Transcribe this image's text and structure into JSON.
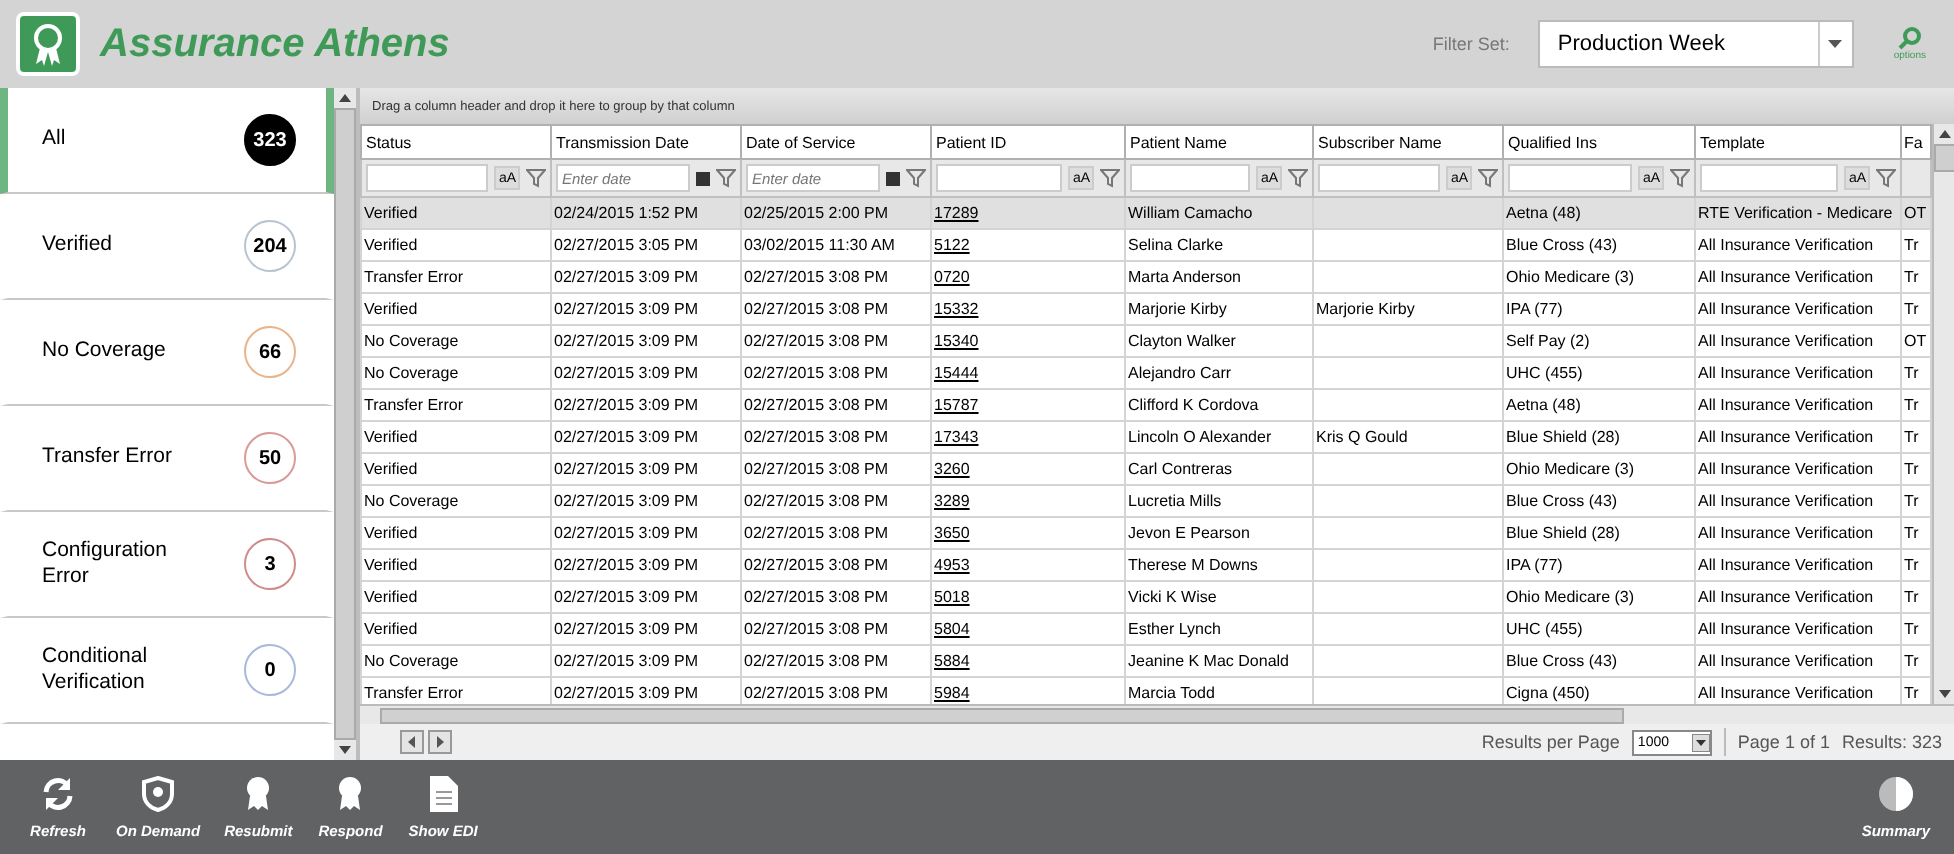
{
  "header": {
    "title": "Assurance Athens",
    "filter_label": "Filter Set:",
    "filter_value": "Production Week",
    "options_label": "options"
  },
  "sidebar": {
    "items": [
      {
        "label": "All",
        "count": "323",
        "selected": true,
        "color": "#000000"
      },
      {
        "label": "Verified",
        "count": "204",
        "selected": false,
        "color": "#b8c4d0"
      },
      {
        "label": "No Coverage",
        "count": "66",
        "selected": false,
        "color": "#e8b48c"
      },
      {
        "label": "Transfer Error",
        "count": "50",
        "selected": false,
        "color": "#d99a9a"
      },
      {
        "label": "Configuration Error",
        "count": "3",
        "selected": false,
        "color": "#d08c8c"
      },
      {
        "label": "Conditional Verification",
        "count": "0",
        "selected": false,
        "color": "#a9b8dc"
      }
    ]
  },
  "grid": {
    "group_hint": "Drag a column header and drop it here to group by that column",
    "columns": [
      {
        "title": "Status",
        "kind": "text",
        "case_toggle": "aA"
      },
      {
        "title": "Transmission Date",
        "kind": "date",
        "placeholder": "Enter date"
      },
      {
        "title": "Date of Service",
        "kind": "date",
        "placeholder": "Enter date"
      },
      {
        "title": "Patient ID",
        "kind": "link",
        "case_toggle": "aA"
      },
      {
        "title": "Patient Name",
        "kind": "text",
        "case_toggle": "aA"
      },
      {
        "title": "Subscriber Name",
        "kind": "text",
        "case_toggle": "aA"
      },
      {
        "title": "Qualified Ins",
        "kind": "text",
        "case_toggle": "aA"
      },
      {
        "title": "Template",
        "kind": "text",
        "case_toggle": "aA"
      },
      {
        "title": "Fa",
        "kind": "plain"
      }
    ],
    "rows": [
      {
        "selected": true,
        "cells": [
          "Verified",
          "02/24/2015 1:52 PM",
          "02/25/2015 2:00 PM",
          "17289",
          "William  Camacho",
          "",
          "Aetna (48)",
          "RTE Verification - Medicare",
          "OT"
        ]
      },
      {
        "selected": false,
        "cells": [
          "Verified",
          "02/27/2015 3:05 PM",
          "03/02/2015 11:30 AM",
          "5122",
          "Selina  Clarke",
          "",
          "Blue Cross (43)",
          "All Insurance Verification",
          "Tr"
        ]
      },
      {
        "selected": false,
        "cells": [
          "Transfer Error",
          "02/27/2015 3:09 PM",
          "02/27/2015 3:08 PM",
          "0720",
          "Marta  Anderson",
          "",
          "Ohio Medicare (3)",
          "All Insurance Verification",
          "Tr"
        ]
      },
      {
        "selected": false,
        "cells": [
          "Verified",
          "02/27/2015 3:09 PM",
          "02/27/2015 3:08 PM",
          "15332",
          "Marjorie  Kirby",
          "Marjorie Kirby",
          "IPA (77)",
          "All Insurance Verification",
          "Tr"
        ]
      },
      {
        "selected": false,
        "cells": [
          "No Coverage",
          "02/27/2015 3:09 PM",
          "02/27/2015 3:08 PM",
          "15340",
          "Clayton  Walker",
          "",
          "Self Pay (2)",
          "All Insurance Verification",
          "OT"
        ]
      },
      {
        "selected": false,
        "cells": [
          "No Coverage",
          "02/27/2015 3:09 PM",
          "02/27/2015 3:08 PM",
          "15444",
          "Alejandro  Carr",
          "",
          "UHC (455)",
          "All Insurance Verification",
          "Tr"
        ]
      },
      {
        "selected": false,
        "cells": [
          "Transfer Error",
          "02/27/2015 3:09 PM",
          "02/27/2015 3:08 PM",
          "15787",
          "Clifford K Cordova",
          "",
          "Aetna (48)",
          "All Insurance Verification",
          "Tr"
        ]
      },
      {
        "selected": false,
        "cells": [
          "Verified",
          "02/27/2015 3:09 PM",
          "02/27/2015 3:08 PM",
          "17343",
          "Lincoln O Alexander",
          "Kris Q Gould",
          "Blue Shield (28)",
          "All Insurance Verification",
          "Tr"
        ]
      },
      {
        "selected": false,
        "cells": [
          "Verified",
          "02/27/2015 3:09 PM",
          "02/27/2015 3:08 PM",
          "3260",
          "Carl  Contreras",
          "",
          "Ohio Medicare (3)",
          "All Insurance Verification",
          "Tr"
        ]
      },
      {
        "selected": false,
        "cells": [
          "No Coverage",
          "02/27/2015 3:09 PM",
          "02/27/2015 3:08 PM",
          "3289",
          "Lucretia  Mills",
          "",
          "Blue Cross (43)",
          "All Insurance Verification",
          "Tr"
        ]
      },
      {
        "selected": false,
        "cells": [
          "Verified",
          "02/27/2015 3:09 PM",
          "02/27/2015 3:08 PM",
          "3650",
          "Jevon E Pearson",
          "",
          "Blue Shield (28)",
          "All Insurance Verification",
          "Tr"
        ]
      },
      {
        "selected": false,
        "cells": [
          "Verified",
          "02/27/2015 3:09 PM",
          "02/27/2015 3:08 PM",
          "4953",
          "Therese M Downs",
          "",
          "IPA (77)",
          "All Insurance Verification",
          "Tr"
        ]
      },
      {
        "selected": false,
        "cells": [
          "Verified",
          "02/27/2015 3:09 PM",
          "02/27/2015 3:08 PM",
          "5018",
          "Vicki K Wise",
          "",
          "Ohio Medicare (3)",
          "All Insurance Verification",
          "Tr"
        ]
      },
      {
        "selected": false,
        "cells": [
          "Verified",
          "02/27/2015 3:09 PM",
          "02/27/2015 3:08 PM",
          "5804",
          "Esther  Lynch",
          "",
          "UHC (455)",
          "All Insurance Verification",
          "Tr"
        ]
      },
      {
        "selected": false,
        "cells": [
          "No Coverage",
          "02/27/2015 3:09 PM",
          "02/27/2015 3:08 PM",
          "5884",
          "Jeanine K Mac Donald",
          "",
          "Blue Cross (43)",
          "All Insurance Verification",
          "Tr"
        ]
      },
      {
        "selected": false,
        "cells": [
          "Transfer Error",
          "02/27/2015 3:09 PM",
          "02/27/2015 3:08 PM",
          "5984",
          "Marcia  Todd",
          "",
          "Cigna (450)",
          "All Insurance Verification",
          "Tr"
        ]
      }
    ]
  },
  "pager": {
    "results_per_page_label": "Results per Page",
    "page_size": "1000",
    "page_info": "Page 1 of 1",
    "results": "Results: 323"
  },
  "toolbar": [
    {
      "label": "Refresh",
      "kind": "refresh"
    },
    {
      "label": "On Demand",
      "kind": "shield"
    },
    {
      "label": "Resubmit",
      "kind": "ribbon"
    },
    {
      "label": "Respond",
      "kind": "ribbon"
    },
    {
      "label": "Show EDI",
      "kind": "document"
    },
    {
      "label": "Summary",
      "kind": "pie"
    }
  ]
}
